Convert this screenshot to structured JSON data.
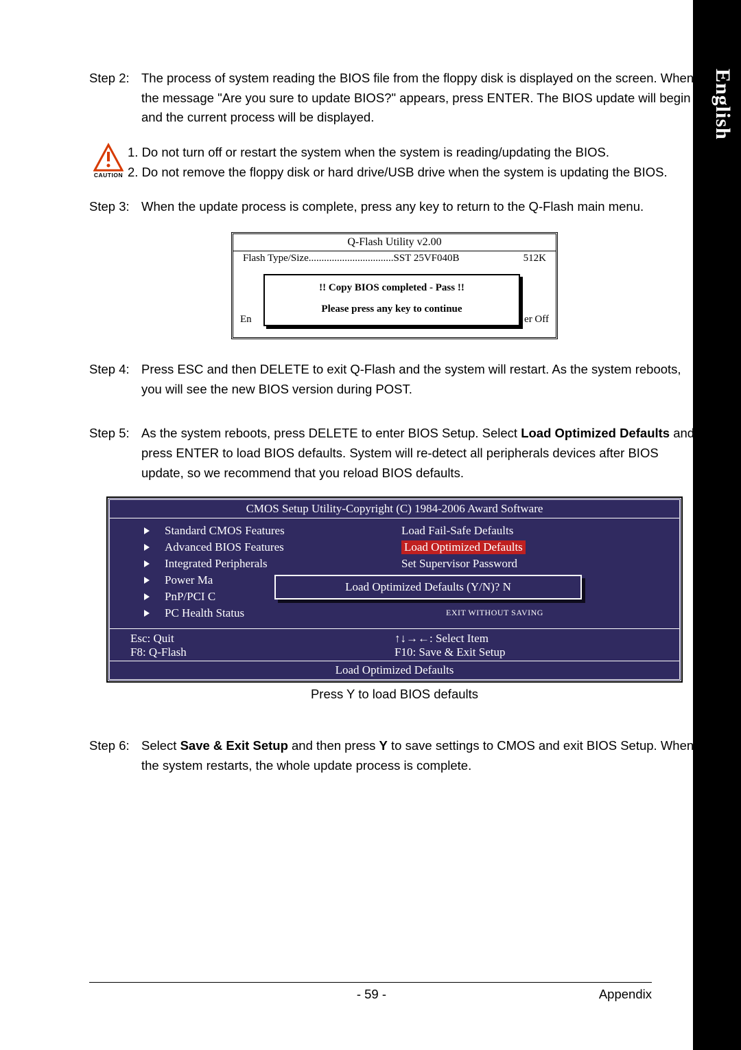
{
  "language_tab": "English",
  "step2": {
    "label": "Step 2:",
    "body": "The process of system reading the BIOS file from the floppy disk is displayed on the screen. When the message \"Are you sure to update BIOS?\" appears, press ENTER. The BIOS update will begin and the current process will be displayed."
  },
  "caution": {
    "label": "CAUTION",
    "line1": "1. Do not turn off or restart the system when the system is reading/updating the BIOS.",
    "line2": "2. Do not remove the floppy disk or hard drive/USB drive when the system is updating the BIOS."
  },
  "step3": {
    "label": "Step 3:",
    "body": "When the update process is complete, press any key to return to the Q-Flash main menu."
  },
  "qflash": {
    "title": "Q-Flash Utility v2.00",
    "flash_label": "Flash Type/Size.................................SST 25VF040B",
    "flash_size": "512K",
    "behind_left": "En",
    "behind_right": "er Off",
    "msg1": "!! Copy BIOS completed - Pass !!",
    "msg2": "Please press any key to continue"
  },
  "step4": {
    "label": "Step 4:",
    "body": "Press ESC and then DELETE to exit Q-Flash and the system will restart. As the system reboots, you will see the new BIOS version during POST."
  },
  "step5": {
    "label": "Step 5:",
    "body_pre": "As the system reboots, press DELETE to enter BIOS Setup. Select ",
    "body_bold": "Load Optimized Defaults",
    "body_post": " and press ENTER to load BIOS defaults. System will re-detect all peripherals devices after BIOS update, so we recommend that you reload BIOS defaults."
  },
  "cmos": {
    "title": "CMOS Setup Utility-Copyright (C) 1984-2006 Award Software",
    "left": [
      "Standard CMOS Features",
      "Advanced BIOS Features",
      "Integrated Peripherals",
      "Power Ma",
      "PnP/PCI C",
      "PC Health Status"
    ],
    "right": [
      "Load Fail-Safe Defaults",
      "Load Optimized Defaults",
      "Set Supervisor Password"
    ],
    "dialog": "Load Optimized Defaults (Y/N)? N",
    "exit_without": "Exit Without Saving",
    "help": {
      "esc": "Esc: Quit",
      "select": "↑↓→←: Select Item",
      "f8": "F8: Q-Flash",
      "f10": "F10: Save & Exit Setup"
    },
    "footer": "Load Optimized Defaults"
  },
  "fig_caption": "Press Y to load BIOS defaults",
  "step6": {
    "label": "Step 6:",
    "pre": "Select ",
    "b1": "Save & Exit Setup",
    "mid": " and then press ",
    "b2": "Y",
    "post": " to save settings to CMOS and exit BIOS Setup. When the system restarts, the whole update process is complete."
  },
  "footer": {
    "page": "- 59 -",
    "section": "Appendix"
  }
}
